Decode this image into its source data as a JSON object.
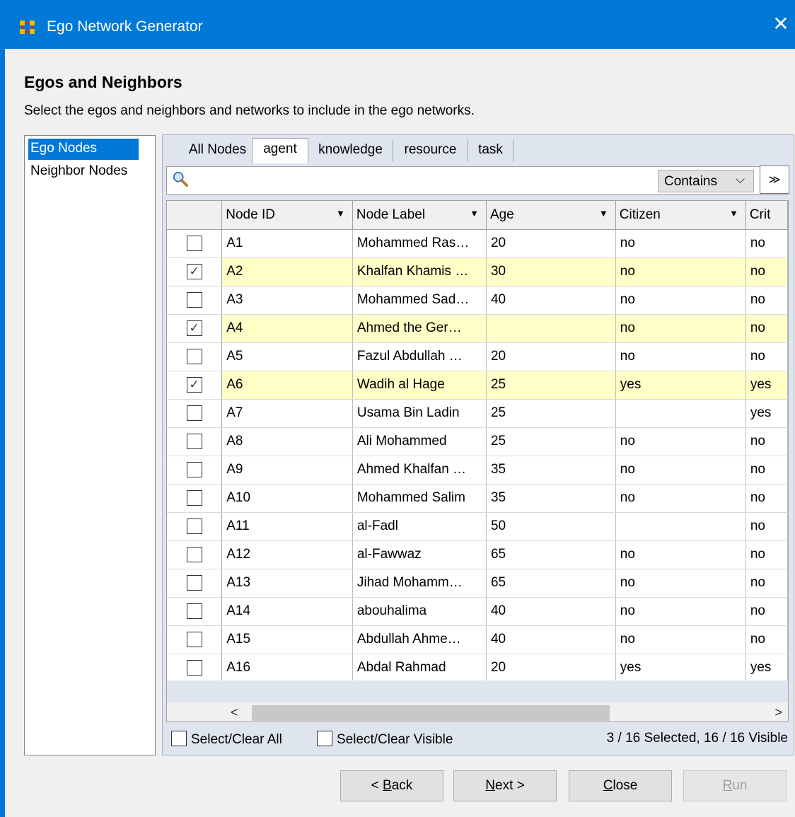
{
  "window": {
    "title": "Ego Network Generator",
    "close_glyph": "✕",
    "accent_color": "#0078d7"
  },
  "page": {
    "heading": "Egos and Neighbors",
    "subheading": "Select the egos and neighbors and networks to include in the ego networks."
  },
  "left_list": {
    "items": [
      {
        "label": "Ego Nodes",
        "selected": true
      },
      {
        "label": "Neighbor Nodes",
        "selected": false
      }
    ]
  },
  "tabs": [
    "All Nodes",
    "agent",
    "knowledge",
    "resource",
    "task"
  ],
  "active_tab": "agent",
  "search": {
    "value": "",
    "icon": "search-icon",
    "mode": "Contains",
    "mode_arrow": "⌵",
    "expand_glyph": "≫"
  },
  "columns": [
    "Node ID",
    "Node Label",
    "Age",
    "Citizen",
    "Crit"
  ],
  "rows": [
    {
      "checked": false,
      "id": "A1",
      "label": "Mohammed Ras…",
      "age": "20",
      "citizen": "no",
      "crit": "no"
    },
    {
      "checked": true,
      "id": "A2",
      "label": "Khalfan Khamis …",
      "age": "30",
      "citizen": "no",
      "crit": "no"
    },
    {
      "checked": false,
      "id": "A3",
      "label": "Mohammed Sad…",
      "age": "40",
      "citizen": "no",
      "crit": "no"
    },
    {
      "checked": true,
      "id": "A4",
      "label": "Ahmed the Ger…",
      "age": "",
      "citizen": "no",
      "crit": "no"
    },
    {
      "checked": false,
      "id": "A5",
      "label": "Fazul Abdullah …",
      "age": "20",
      "citizen": "no",
      "crit": "no"
    },
    {
      "checked": true,
      "id": "A6",
      "label": "Wadih al Hage",
      "age": "25",
      "citizen": "yes",
      "crit": "yes"
    },
    {
      "checked": false,
      "id": "A7",
      "label": "Usama Bin Ladin",
      "age": "25",
      "citizen": "",
      "crit": "yes"
    },
    {
      "checked": false,
      "id": "A8",
      "label": "Ali Mohammed",
      "age": "25",
      "citizen": "no",
      "crit": "no"
    },
    {
      "checked": false,
      "id": "A9",
      "label": "Ahmed Khalfan …",
      "age": "35",
      "citizen": "no",
      "crit": "no"
    },
    {
      "checked": false,
      "id": "A10",
      "label": "Mohammed Salim",
      "age": "35",
      "citizen": "no",
      "crit": "no"
    },
    {
      "checked": false,
      "id": "A11",
      "label": "al-Fadl",
      "age": "50",
      "citizen": "",
      "crit": "no"
    },
    {
      "checked": false,
      "id": "A12",
      "label": "al-Fawwaz",
      "age": "65",
      "citizen": "no",
      "crit": "no"
    },
    {
      "checked": false,
      "id": "A13",
      "label": "Jihad Mohamm…",
      "age": "65",
      "citizen": "no",
      "crit": "no"
    },
    {
      "checked": false,
      "id": "A14",
      "label": "abouhalima",
      "age": "40",
      "citizen": "no",
      "crit": "no"
    },
    {
      "checked": false,
      "id": "A15",
      "label": "Abdullah Ahme…",
      "age": "40",
      "citizen": "no",
      "crit": "no"
    },
    {
      "checked": false,
      "id": "A16",
      "label": "Abdal Rahmad",
      "age": "20",
      "citizen": "yes",
      "crit": "yes"
    }
  ],
  "scroll": {
    "left_glyph": "<",
    "right_glyph": ">"
  },
  "footer": {
    "select_all": "Select/Clear All",
    "select_visible": "Select/Clear Visible",
    "status": "3 / 16 Selected, 16 / 16 Visible"
  },
  "buttons": {
    "back": {
      "label": "< Back",
      "mnemonic": "B",
      "enabled": true
    },
    "next": {
      "label": "Next >",
      "mnemonic": "N",
      "enabled": true
    },
    "close": {
      "label": "Close",
      "mnemonic": "C",
      "enabled": true
    },
    "run": {
      "label": "Run",
      "mnemonic": "R",
      "enabled": false
    }
  },
  "check_glyph": "✓",
  "highlight_color": "#ffffc8",
  "header_dropdown_glyph": "▼"
}
